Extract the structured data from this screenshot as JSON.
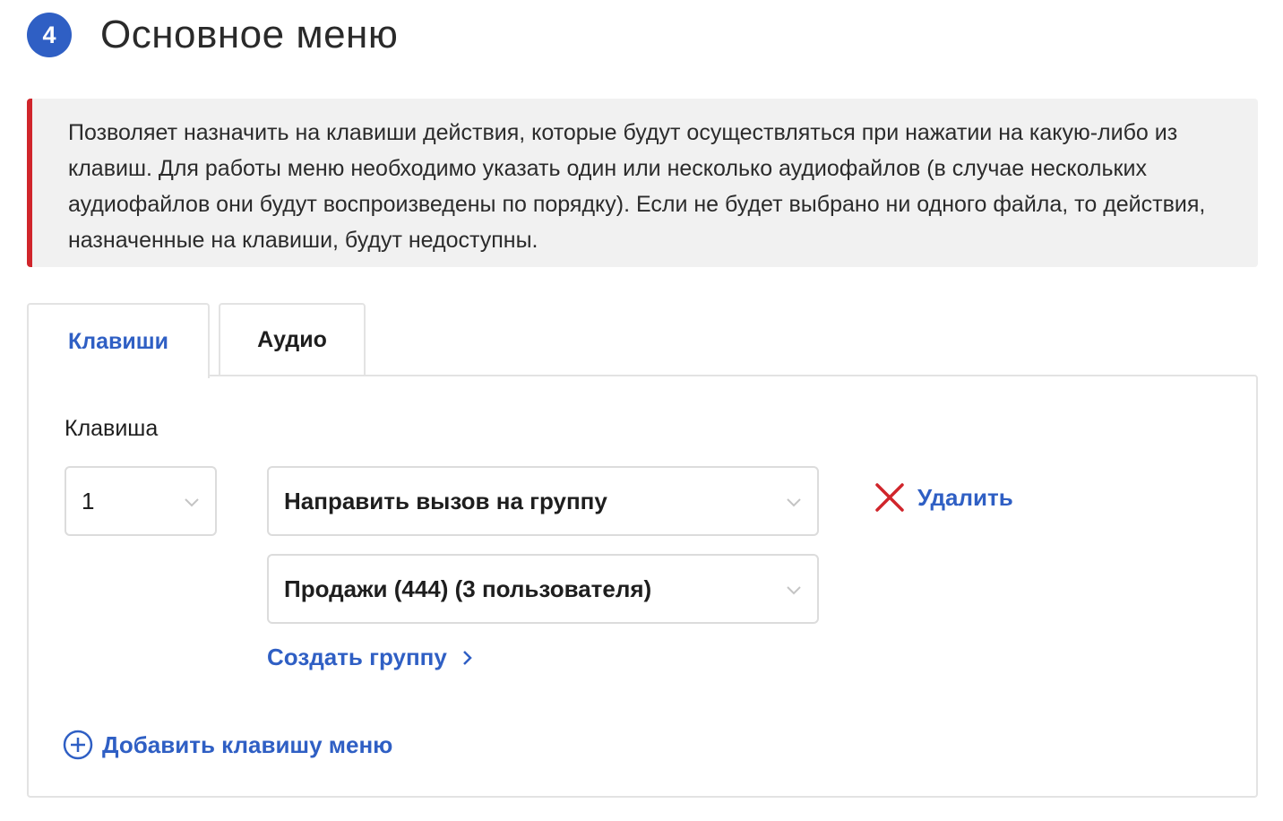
{
  "section": {
    "step_number": "4",
    "title": "Основное меню"
  },
  "info": {
    "text": "Позволяет назначить на клавиши действия, которые будут осуществляться при нажатии на какую-либо из клавиш. Для работы меню необходимо указать один или несколько аудиофайлов (в случае нескольких аудиофайлов они будут воспроизведены по порядку). Если не будет выбрано ни одного файла, то действия, назначенные на клавиши, будут недоступны.",
    "accent_color": "#d0252b"
  },
  "tabs": [
    {
      "label": "Клавиши",
      "active": true
    },
    {
      "label": "Аудио",
      "active": false
    }
  ],
  "form": {
    "key_label": "Клавиша",
    "key_value": "1",
    "action_value": "Направить вызов на группу",
    "group_value": "Продажи (444) (3 пользователя)",
    "delete_label": "Удалить",
    "create_group_label": "Создать группу",
    "add_key_label": "Добавить клавишу меню"
  },
  "colors": {
    "accent": "#2f5fc4",
    "danger": "#d0252b"
  },
  "icons": {
    "delete": "close-icon",
    "create_group": "chevron-right-icon",
    "add_key": "plus-circle-icon",
    "select": "chevron-down-icon"
  }
}
